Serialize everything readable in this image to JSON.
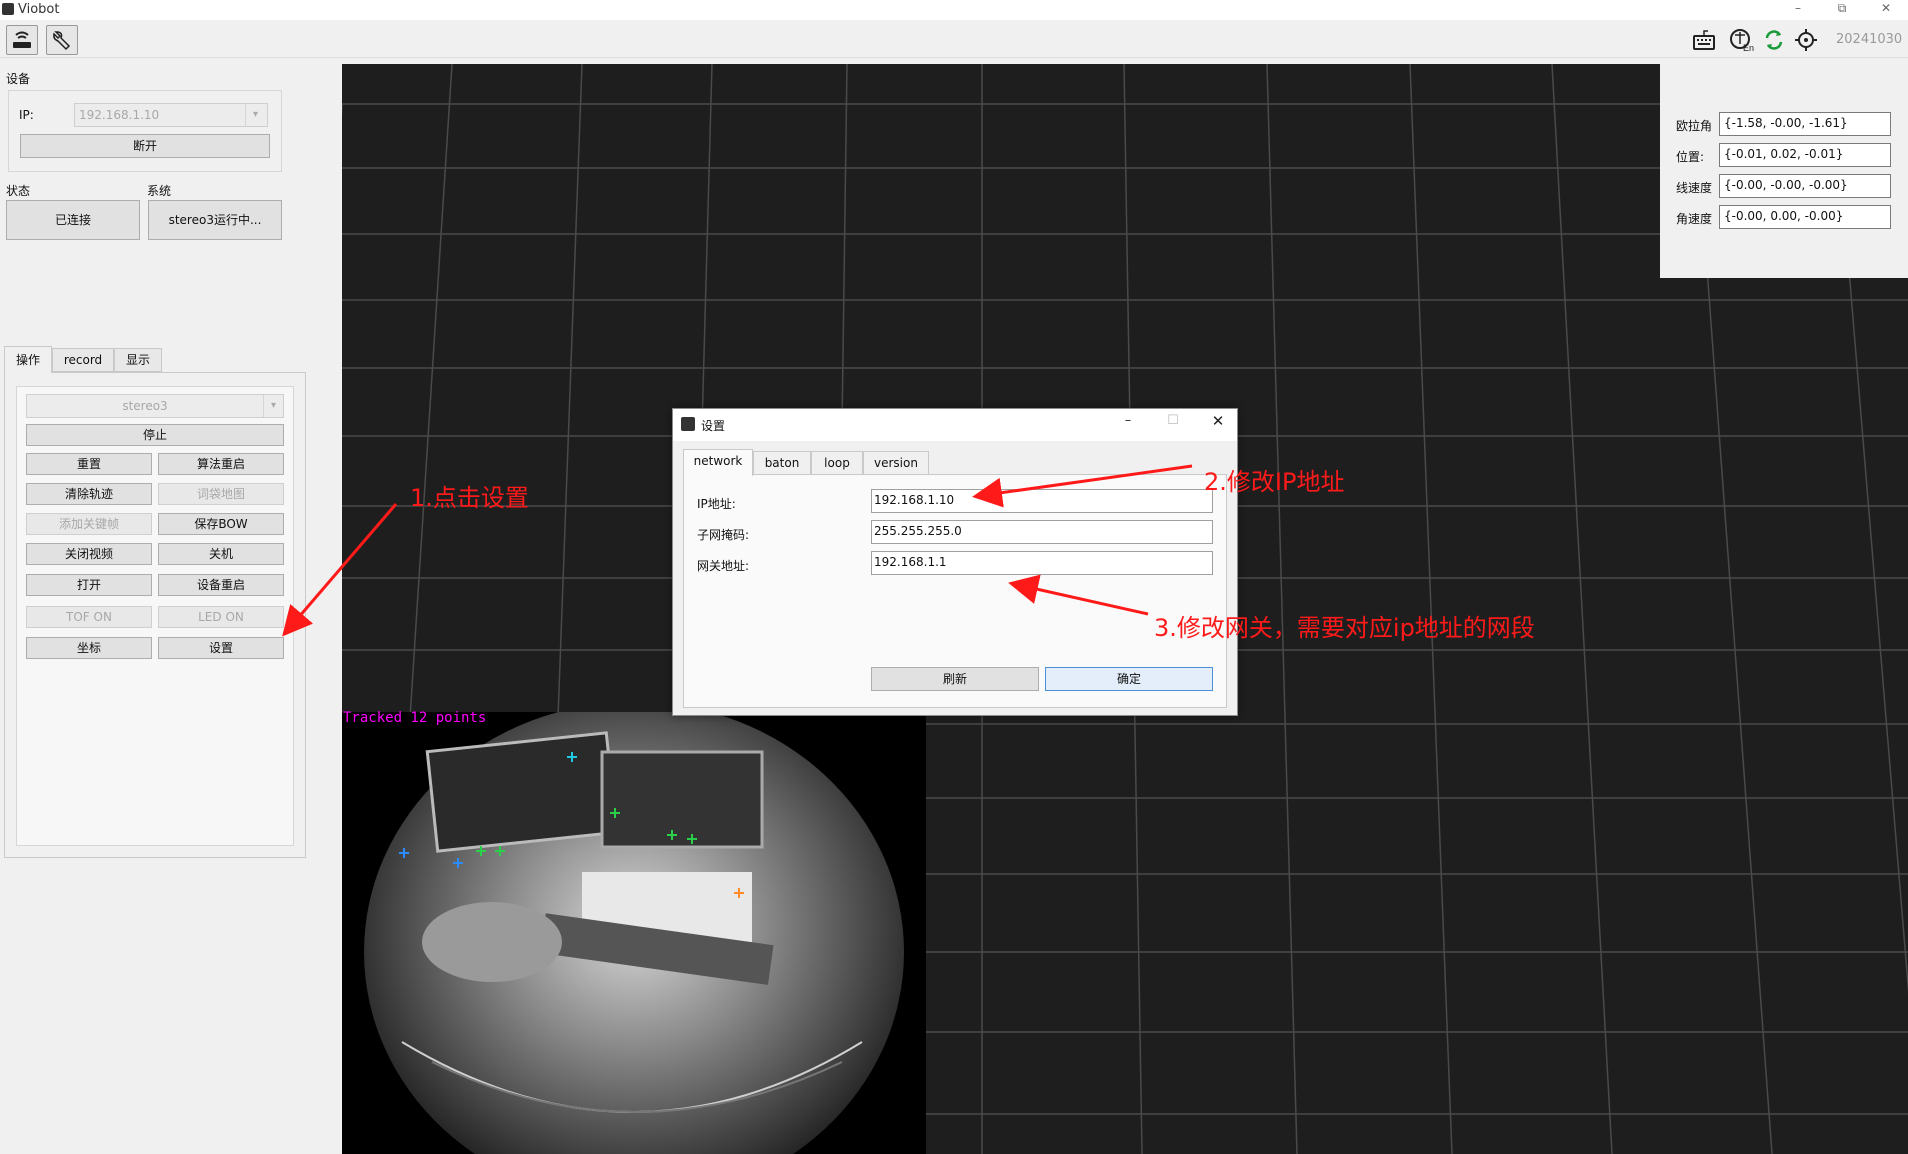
{
  "window": {
    "title": "Viobot",
    "minimize": "–",
    "restore": "⧉",
    "close": "✕"
  },
  "toolbar": {
    "version": "20241030"
  },
  "device": {
    "section_label": "设备",
    "ip_label": "IP:",
    "ip_value": "192.168.1.10",
    "disconnect_label": "断开"
  },
  "status": {
    "label": "状态",
    "value": "已连接"
  },
  "system": {
    "label": "系统",
    "value": "stereo3运行中..."
  },
  "tabs": [
    "操作",
    "record",
    "显示"
  ],
  "operations": {
    "algo_select": "stereo3",
    "stop": "停止",
    "buttons": [
      {
        "label": "重置",
        "enabled": true
      },
      {
        "label": "算法重启",
        "enabled": true
      },
      {
        "label": "清除轨迹",
        "enabled": true
      },
      {
        "label": "词袋地图",
        "enabled": false
      },
      {
        "label": "添加关键帧",
        "enabled": false
      },
      {
        "label": "保存BOW",
        "enabled": true
      },
      {
        "label": "关闭视频",
        "enabled": true
      },
      {
        "label": "关机",
        "enabled": true
      },
      {
        "label": "打开",
        "enabled": true
      },
      {
        "label": "设备重启",
        "enabled": true
      },
      {
        "label": "TOF ON",
        "enabled": false
      },
      {
        "label": "LED ON",
        "enabled": false
      },
      {
        "label": "坐标",
        "enabled": true
      },
      {
        "label": "设置",
        "enabled": true
      }
    ]
  },
  "pose": [
    {
      "label": "欧拉角",
      "value": "{-1.58, -0.00, -1.61}"
    },
    {
      "label": "位置:",
      "value": "{-0.01, 0.02, -0.01}"
    },
    {
      "label": "线速度",
      "value": "{-0.00, -0.00, -0.00}"
    },
    {
      "label": "角速度",
      "value": "{-0.00, 0.00, -0.00}"
    }
  ],
  "camera": {
    "tracked_text": "Tracked 12 points"
  },
  "dialog": {
    "title": "设置",
    "tabs": [
      "network",
      "baton",
      "loop",
      "version"
    ],
    "fields": [
      {
        "label": "IP地址:",
        "value": "192.168.1.10"
      },
      {
        "label": "子网掩码:",
        "value": "255.255.255.0"
      },
      {
        "label": "网关地址:",
        "value": "192.168.1.1"
      }
    ],
    "refresh": "刷新",
    "confirm": "确定"
  },
  "annotations": {
    "step1": "1.点击设置",
    "step2": "2.修改IP地址",
    "step3": "3.修改网关，需要对应ip地址的网段"
  },
  "colors": {
    "annotation": "#ff1a1a",
    "viewport": "#1e1e1e",
    "tracked_text": "#ff00ff"
  }
}
